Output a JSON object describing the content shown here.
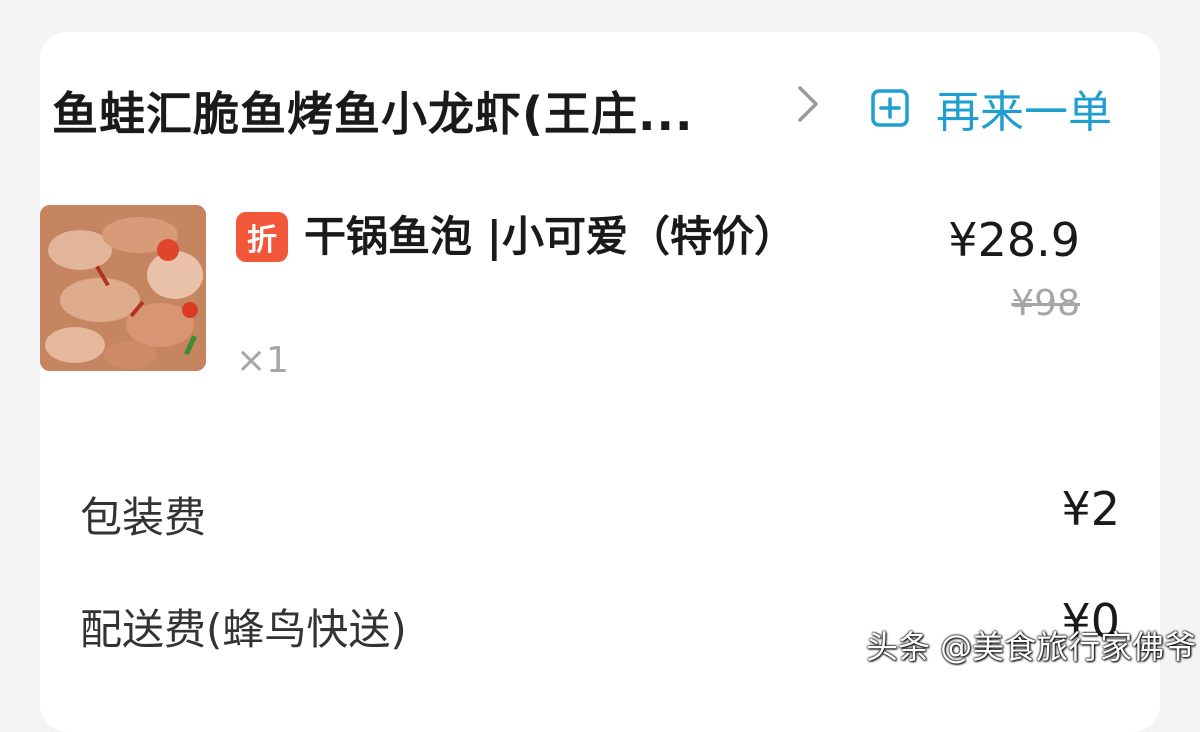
{
  "header": {
    "shop_name": "鱼蛙汇脆鱼烤鱼小龙虾(王庄...",
    "reorder_label": "再来一单"
  },
  "item": {
    "badge": "折",
    "name": "干锅鱼泡 |小可爱（特价）",
    "quantity": "×1",
    "price": "¥28.9",
    "original_price": "¥98"
  },
  "fees": [
    {
      "label": "包装费",
      "value": "¥2"
    },
    {
      "label": "配送费(蜂鸟快送)",
      "value": "¥0"
    }
  ],
  "watermark": "头条 @美食旅行家佛爷",
  "colors": {
    "accent": "#1e9fd0",
    "badge": "#f2573a",
    "muted": "#a6a6a6"
  },
  "icons": {
    "chevron": "chevron-right-icon",
    "reorder": "plus-square-icon"
  }
}
